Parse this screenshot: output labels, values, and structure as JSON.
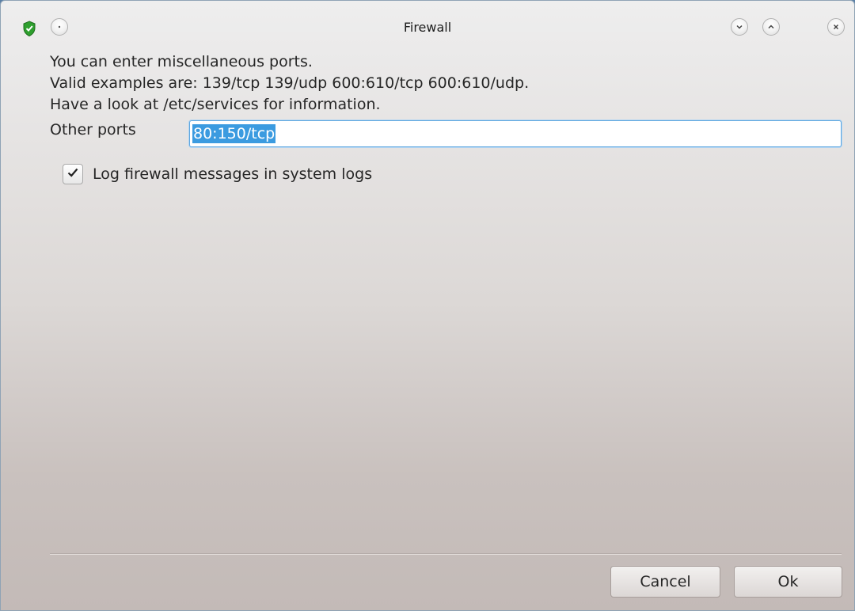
{
  "window": {
    "title": "Firewall"
  },
  "titlebar": {
    "app_icon": "shield-check-icon",
    "menu_icon": "dot-icon",
    "minimize_icon": "chevron-down-icon",
    "maximize_icon": "chevron-up-icon",
    "close_icon": "close-icon"
  },
  "info": {
    "line1": "You can enter miscellaneous ports.",
    "line2": "Valid examples are: 139/tcp 139/udp 600:610/tcp 600:610/udp.",
    "line3": "Have a look at /etc/services for information."
  },
  "ports": {
    "label": "Other ports",
    "value": "80:150/tcp"
  },
  "log_option": {
    "label": "Log firewall messages in system logs",
    "checked": true
  },
  "buttons": {
    "cancel": "Cancel",
    "ok": "Ok"
  },
  "colors": {
    "accent": "#3b9be0",
    "shield_green": "#2e9f2e"
  }
}
